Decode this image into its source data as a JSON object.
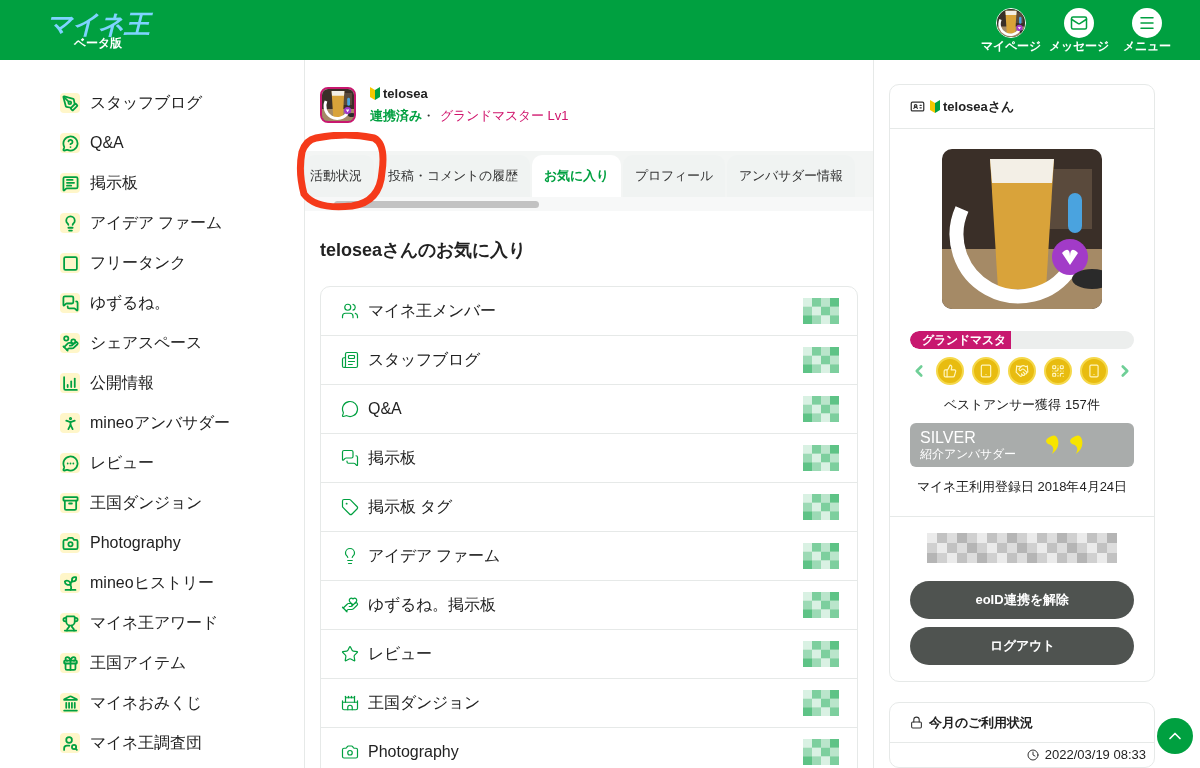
{
  "header": {
    "logo": "マイネ王",
    "logo_sub": "ベータ版",
    "nav": [
      {
        "label": "マイページ",
        "kind": "avatar"
      },
      {
        "label": "メッセージ",
        "kind": "mail"
      },
      {
        "label": "メニュー",
        "kind": "menu"
      }
    ]
  },
  "sidebar": {
    "items": [
      {
        "label": "スタッフブログ"
      },
      {
        "label": "Q&A"
      },
      {
        "label": "掲示板"
      },
      {
        "label": "アイデア ファーム"
      },
      {
        "label": "フリータンク"
      },
      {
        "label": "ゆずるね。"
      },
      {
        "label": "シェアスペース"
      },
      {
        "label": "公開情報"
      },
      {
        "label": "mineoアンバサダー"
      },
      {
        "label": "レビュー"
      },
      {
        "label": "王国ダンジョン"
      },
      {
        "label": "Photography"
      },
      {
        "label": "mineoヒストリー"
      },
      {
        "label": "マイネ王アワード"
      },
      {
        "label": "王国アイテム"
      },
      {
        "label": "マイネおみくじ"
      },
      {
        "label": "マイネ王調査団"
      }
    ]
  },
  "profile": {
    "name": "telosea",
    "status": "連携済み",
    "separator": "・",
    "rank": "グランドマスター Lv1"
  },
  "tabs": [
    {
      "label": "活動状況",
      "selected": false
    },
    {
      "label": "投稿・コメントの履歴",
      "selected": false
    },
    {
      "label": "お気に入り",
      "selected": true
    },
    {
      "label": "プロフィール",
      "selected": false
    },
    {
      "label": "アンバサダー情報",
      "selected": false
    }
  ],
  "favorites": {
    "title": "teloseaさんのお気に入り",
    "items": [
      {
        "label": "マイネ王メンバー"
      },
      {
        "label": "スタッフブログ"
      },
      {
        "label": "Q&A"
      },
      {
        "label": "掲示板"
      },
      {
        "label": "掲示板 タグ"
      },
      {
        "label": "アイデア ファーム"
      },
      {
        "label": "ゆずるね。掲示板"
      },
      {
        "label": "レビュー"
      },
      {
        "label": "王国ダンジョン"
      },
      {
        "label": "Photography"
      }
    ]
  },
  "user_card": {
    "title": "teloseaさん",
    "rank_label": "グランドマスタ",
    "level": 0.45,
    "best_answer": "ベストアンサー獲得 157件",
    "ambassador": {
      "tier": "SILVER",
      "label": "紹介アンバサダー"
    },
    "registered": "マイネ王利用登録日 2018年4月24日",
    "buttons": [
      "eoID連携を解除",
      "ログアウト"
    ]
  },
  "usage_card": {
    "title": "今月のご利用状況",
    "timestamp": "2022/03/19 08:33"
  }
}
